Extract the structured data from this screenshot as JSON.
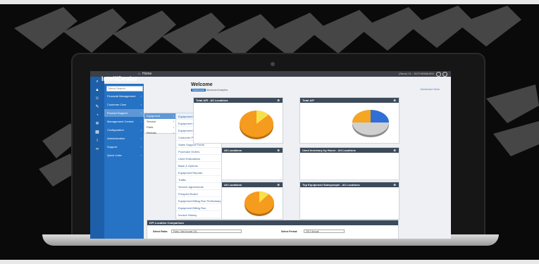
{
  "app": {
    "logo": "IntelliDealer",
    "breadcrumb": "Home",
    "location": "(Store) 01 · GOTHENBURG"
  },
  "sidebar_menu": {
    "search_placeholder": "Menu Search",
    "items": [
      {
        "label": "Financial Management",
        "icon": "chart-icon"
      },
      {
        "label": "Customer Care",
        "icon": "people-icon"
      },
      {
        "label": "Product Support",
        "icon": "wrench-icon",
        "active": true
      },
      {
        "label": "Management Central",
        "icon": "dashboard-icon"
      },
      {
        "label": "Configuration",
        "icon": "gears-icon"
      },
      {
        "label": "Administration",
        "icon": "bank-icon"
      },
      {
        "label": "Support",
        "icon": "info-icon"
      },
      {
        "label": "Quick Links",
        "icon": "link-icon"
      }
    ]
  },
  "submenu_level1": {
    "items": [
      "Equipment",
      "Service",
      "Parts",
      "Rentals"
    ],
    "active": "Equipment"
  },
  "submenu_level2": {
    "items": [
      "Equipment Profile (New - EPF)",
      "Equipment Quoting",
      "Equipment Invoicing",
      "Customer Portal",
      "Sales Support Portal",
      "Purchase Orders",
      "Used Evaluations",
      "Base & Options",
      "Equipment Reports",
      "Traffic",
      "Service Agreements",
      "Prospect Board",
      "Equipment Billing Run Preliminary",
      "Equipment Billing Run",
      "Invoice History"
    ]
  },
  "dashboard": {
    "title": "Welcome",
    "tabs": [
      "Dashboard",
      "Advanced Analytics"
    ],
    "top_link": "Dashboard Views",
    "widgets": {
      "ar": {
        "title": "Total A/R - All Locations"
      },
      "ap": {
        "title": "Total A/P"
      },
      "equip_loc": {
        "title": "All Locations"
      },
      "used_inv": {
        "title": "Used Inventory by Hours - All Locations"
      },
      "all_loc2": {
        "title": "All Locations"
      },
      "top_sales": {
        "title": "Top Equipment Salespeople - All Locations"
      }
    },
    "kpi": {
      "title": "KPI Location Comparison",
      "select_ratio_label": "Select Ratio:",
      "select_ratio_value": "Parts / Net Income (%)",
      "select_period_label": "Select Period:",
      "select_period_value": "2017 Annual"
    }
  },
  "colors": {
    "sidebar_dark": "#1d5fa8",
    "menu_blue": "#2672c4",
    "widget_header": "#3d4a5a",
    "pie_orange": "#f59b1d",
    "pie_yellow": "#f7e14a"
  }
}
